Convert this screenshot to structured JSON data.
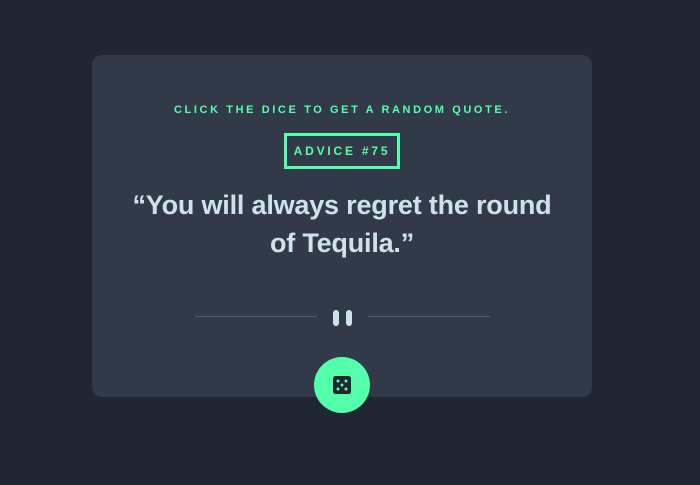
{
  "card": {
    "hint": "CLICK THE DICE TO GET A RANDOM QUOTE.",
    "advice_label": "ADVICE #75",
    "quote": "“You will always regret the round of Tequila.”"
  },
  "icons": {
    "divider": "pause-icon",
    "action": "dice-icon"
  },
  "colors": {
    "background": "#202632",
    "card": "#323a49",
    "accent": "#53ffaa",
    "text": "#cee3e9",
    "divider": "#4f5d74"
  }
}
